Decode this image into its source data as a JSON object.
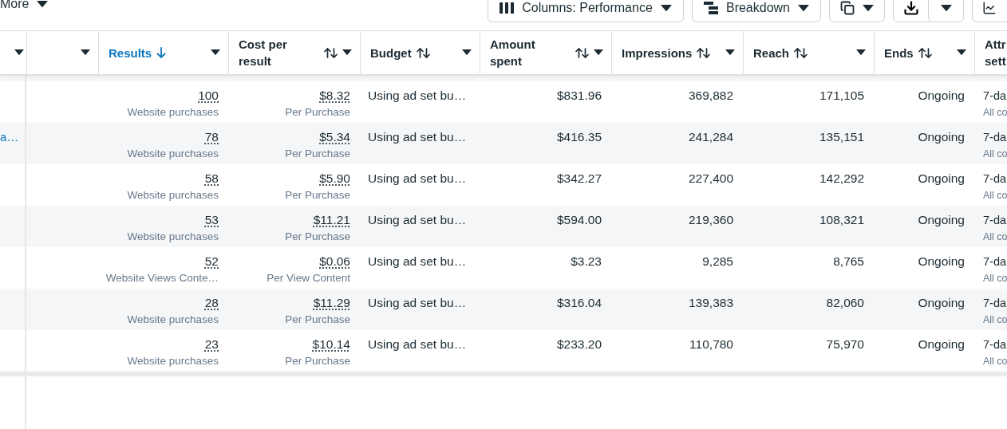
{
  "toolbar": {
    "more": "More",
    "buttons": [
      {
        "kind": "columns",
        "label": "Columns: Performance"
      },
      {
        "kind": "breakdown",
        "label": "Breakdown"
      },
      {
        "kind": "reports"
      },
      {
        "kind": "export"
      },
      {
        "kind": "chart"
      }
    ]
  },
  "table": {
    "columns": [
      {},
      {},
      {
        "label": "Results",
        "sorted": true
      },
      {
        "label": "Cost per result",
        "sorted": false
      },
      {
        "label": "Budget",
        "sorted": false
      },
      {
        "label": "Amount spent",
        "sorted": false
      },
      {
        "label": "Impressions",
        "sorted": false
      },
      {
        "label": "Reach",
        "sorted": false
      },
      {
        "label": "Ends",
        "sorted": false
      },
      {
        "label": "Attr sett"
      }
    ],
    "rows": [
      {
        "results": "100",
        "results_type": "Website purchases",
        "cost": "$8.32",
        "cost_type": "Per Purchase",
        "budget": "Using ad set bu…",
        "amount": "$831.96",
        "impressions": "369,882",
        "reach": "171,105",
        "ends": "Ongoing",
        "attribution": "7-da",
        "attribution_sub": "All co"
      },
      {
        "name": "a…",
        "results": "78",
        "results_type": "Website purchases",
        "cost": "$5.34",
        "cost_type": "Per Purchase",
        "budget": "Using ad set bu…",
        "amount": "$416.35",
        "impressions": "241,284",
        "reach": "135,151",
        "ends": "Ongoing",
        "attribution": "7-da",
        "attribution_sub": "All co"
      },
      {
        "results": "58",
        "results_type": "Website purchases",
        "cost": "$5.90",
        "cost_type": "Per Purchase",
        "budget": "Using ad set bu…",
        "amount": "$342.27",
        "impressions": "227,400",
        "reach": "142,292",
        "ends": "Ongoing",
        "attribution": "7-da",
        "attribution_sub": "All co"
      },
      {
        "results": "53",
        "results_type": "Website purchases",
        "cost": "$11.21",
        "cost_type": "Per Purchase",
        "budget": "Using ad set bu…",
        "amount": "$594.00",
        "impressions": "219,360",
        "reach": "108,321",
        "ends": "Ongoing",
        "attribution": "7-da",
        "attribution_sub": "All co"
      },
      {
        "results": "52",
        "results_type": "Website Views Conte…",
        "cost": "$0.06",
        "cost_type": "Per View Content",
        "budget": "Using ad set bu…",
        "amount": "$3.23",
        "impressions": "9,285",
        "reach": "8,765",
        "ends": "Ongoing",
        "attribution": "7-da",
        "attribution_sub": "All co"
      },
      {
        "results": "28",
        "results_type": "Website purchases",
        "cost": "$11.29",
        "cost_type": "Per Purchase",
        "budget": "Using ad set bu…",
        "amount": "$316.04",
        "impressions": "139,383",
        "reach": "82,060",
        "ends": "Ongoing",
        "attribution": "7-da",
        "attribution_sub": "All co"
      },
      {
        "results": "23",
        "results_type": "Website purchases",
        "cost": "$10.14",
        "cost_type": "Per Purchase",
        "budget": "Using ad set bu…",
        "amount": "$233.20",
        "impressions": "110,780",
        "reach": "75,970",
        "ends": "Ongoing",
        "attribution": "7-da",
        "attribution_sub": "All co"
      }
    ]
  }
}
